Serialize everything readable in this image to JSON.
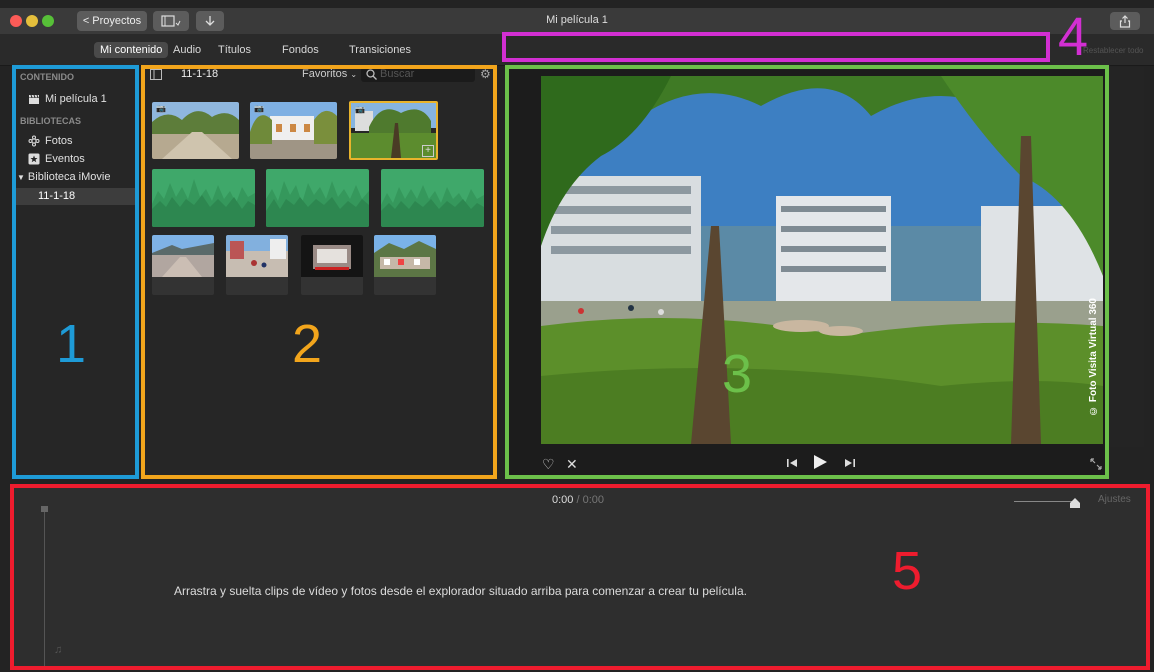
{
  "window": {
    "title": "Mi película 1",
    "projects_button": "Proyectos",
    "back_chevron": "<"
  },
  "tabs": [
    "Mi contenido",
    "Audio",
    "Títulos",
    "Fondos",
    "Transiciones"
  ],
  "sidebar": {
    "section_content": "CONTENIDO",
    "project_item": "Mi película 1",
    "section_libraries": "BIBLIOTECAS",
    "photos": "Fotos",
    "events": "Eventos",
    "library": "Biblioteca iMovie",
    "event_date": "11-1-18"
  },
  "browser": {
    "event_title": "11-1-18",
    "filter": "Favoritos",
    "search_placeholder": "Buscar"
  },
  "viewer": {
    "watermark": "© Foto Visita Virtual 360",
    "reset_all": "Restablecer todo"
  },
  "timeline": {
    "current_time": "0:00",
    "separator": "/",
    "total_time": "0:00",
    "settings": "Ajustes",
    "empty_message": "Arrastra y suelta clips de vídeo y fotos desde el explorador situado arriba para comenzar a crear tu película."
  },
  "annotations": {
    "labels": [
      "1",
      "2",
      "3",
      "4",
      "5"
    ],
    "colors": {
      "1": "#1e9bd7",
      "2": "#f2a51c",
      "3": "#6cc04a",
      "4": "#d22fd2",
      "5": "#ee1c2e"
    }
  },
  "icons": {
    "adjust_toolbar": [
      "magic-wand-icon",
      "color-balance-icon",
      "color-correction-icon",
      "crop-icon",
      "stabilization-icon",
      "volume-icon",
      "noise-reduction-icon",
      "speed-icon",
      "clip-filter-icon",
      "info-icon"
    ],
    "viewer_controls": [
      "favorite-heart-icon",
      "reject-icon",
      "skip-back-icon",
      "play-icon",
      "skip-forward-icon",
      "fullscreen-icon"
    ]
  }
}
